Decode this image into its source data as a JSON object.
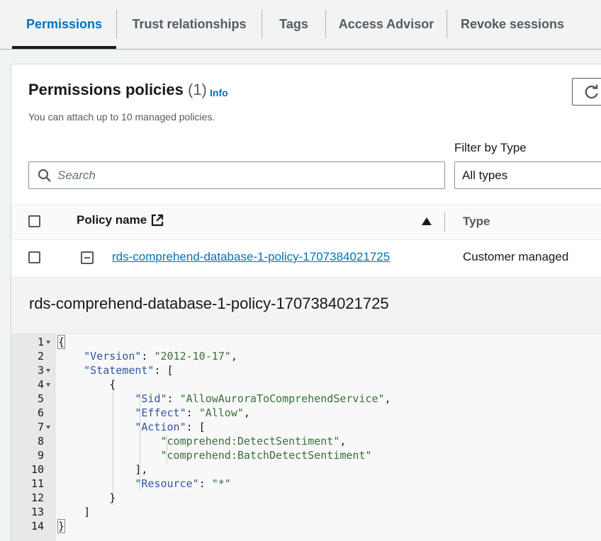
{
  "tabs": [
    {
      "label": "Permissions",
      "active": true
    },
    {
      "label": "Trust relationships",
      "active": false
    },
    {
      "label": "Tags",
      "active": false
    },
    {
      "label": "Access Advisor",
      "active": false
    },
    {
      "label": "Revoke sessions",
      "active": false
    }
  ],
  "section": {
    "title": "Permissions policies",
    "count": "(1)",
    "info_label": "Info",
    "description": "You can attach up to 10 managed policies."
  },
  "filter": {
    "label": "Filter by Type",
    "selected": "All types"
  },
  "search": {
    "placeholder": "Search"
  },
  "table": {
    "columns": [
      "Policy name",
      "Type"
    ],
    "rows": [
      {
        "name": "rds-comprehend-database-1-policy-1707384021725",
        "type": "Customer managed"
      }
    ]
  },
  "detail": {
    "title": "rds-comprehend-database-1-policy-1707384021725",
    "line_numbers": [
      "1",
      "2",
      "3",
      "4",
      "5",
      "6",
      "7",
      "8",
      "9",
      "10",
      "11",
      "12",
      "13",
      "14"
    ],
    "code": {
      "open_brace": "{",
      "version_key": "\"Version\"",
      "version_val": "\"2012-10-17\"",
      "statement_key": "\"Statement\"",
      "sid_key": "\"Sid\"",
      "sid_val": "\"AllowAuroraToComprehendService\"",
      "effect_key": "\"Effect\"",
      "effect_val": "\"Allow\"",
      "action_key": "\"Action\"",
      "action_1": "\"comprehend:DetectSentiment\"",
      "action_2": "\"comprehend:BatchDetectSentiment\"",
      "resource_key": "\"Resource\"",
      "resource_val": "\"*\""
    }
  },
  "colors": {
    "accent": "#0073bb",
    "text": "#16191f",
    "muted": "#545b64"
  }
}
